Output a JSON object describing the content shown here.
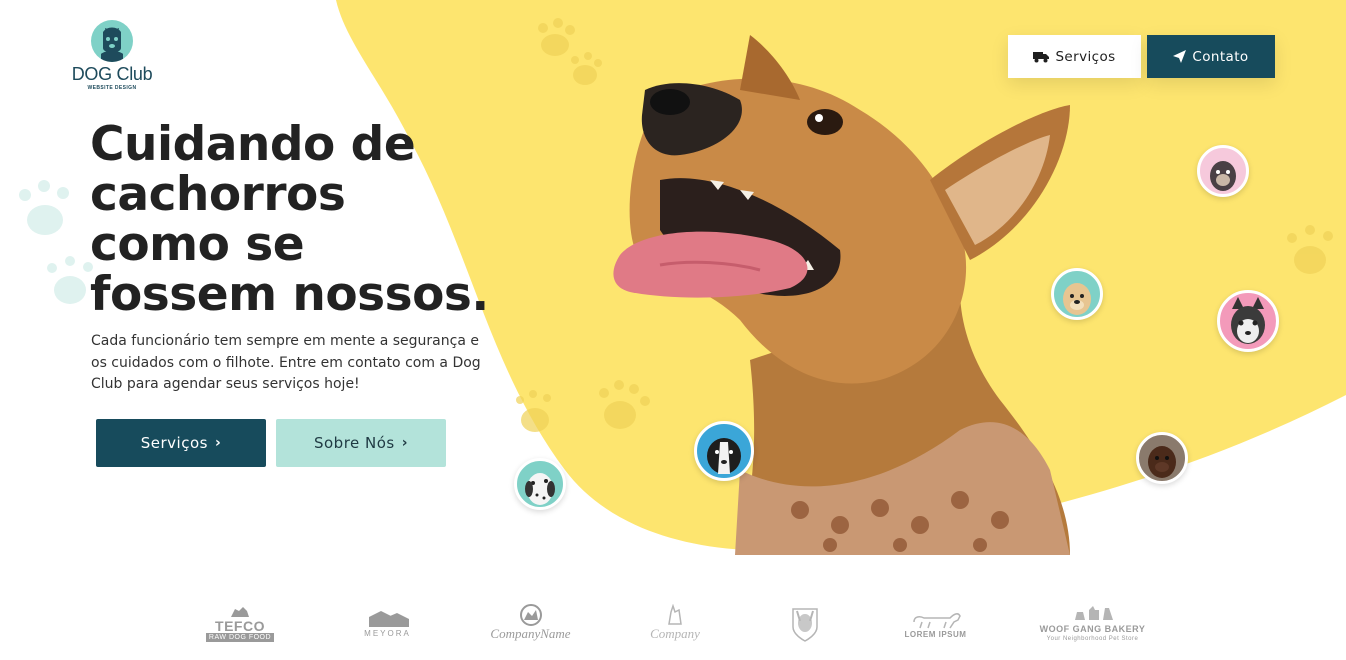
{
  "logo": {
    "name": "DOG Club",
    "tagline": "WEBSITE DESIGN"
  },
  "nav": {
    "servicos_label": "Serviços",
    "servicos_icon": "truck-icon",
    "contato_label": "Contato",
    "contato_icon": "paper-plane-icon"
  },
  "hero": {
    "title_lines": [
      "Cuidando de",
      "cachorros",
      "como se",
      "fossem nossos."
    ],
    "description": "Cada funcionário tem sempre em mente a segurança e os cuidados com o filhote. Entre em contato com a Dog Club para agendar seus serviços hoje!",
    "primary_button": "Serviços",
    "secondary_button": "Sobre Nós",
    "button_icon": "chevron-right-icon"
  },
  "brands": [
    {
      "main": "TEFCO",
      "sub": "RAW DOG FOOD"
    },
    {
      "main": "MEYORA",
      "sub": ""
    },
    {
      "main": "CompanyName",
      "sub": ""
    },
    {
      "main": "Company",
      "sub": ""
    },
    {
      "main": "",
      "sub": ""
    },
    {
      "main": "LOREM IPSUM",
      "sub": ""
    },
    {
      "main": "WOOF GANG BAKERY",
      "sub": "Your Neighborhood Pet Store"
    }
  ],
  "colors": {
    "primary": "#174b5c",
    "secondary": "#b3e3da",
    "accent_yellow": "#fde56f",
    "text_dark": "#222222"
  }
}
